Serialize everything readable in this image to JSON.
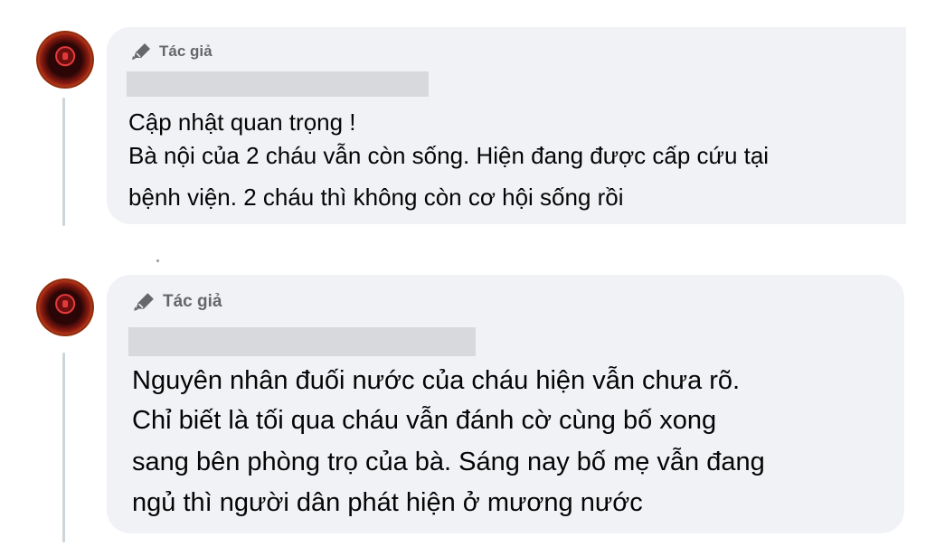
{
  "comments": [
    {
      "author_badge_label": "Tác giả",
      "lines": [
        "Cập nhật quan trọng !",
        "Bà nội của 2 cháu vẫn còn sống. Hiện đang được cấp cứu tại",
        "bệnh viện. 2 cháu thì không còn cơ hội sống rồi"
      ]
    },
    {
      "author_badge_label": "Tác giả",
      "lines": [
        "Nguyên nhân đuối nước của cháu hiện vẫn chưa rõ.",
        "Chỉ biết là tối qua cháu vẫn đánh cờ cùng bố xong",
        "sang bên phòng trọ của bà. Sáng nay bố mẹ vẫn đang",
        "ngủ thì người dân phát hiện ở mương nước"
      ]
    }
  ],
  "icons": {
    "author_badge": "pen-icon",
    "avatar": "avatar"
  },
  "colors": {
    "bubble_bg": "#f0f2f5",
    "badge_text": "#65676b",
    "body_text": "#050505",
    "redaction": "#d8d9dc",
    "thread_line": "#ccd5d9"
  }
}
